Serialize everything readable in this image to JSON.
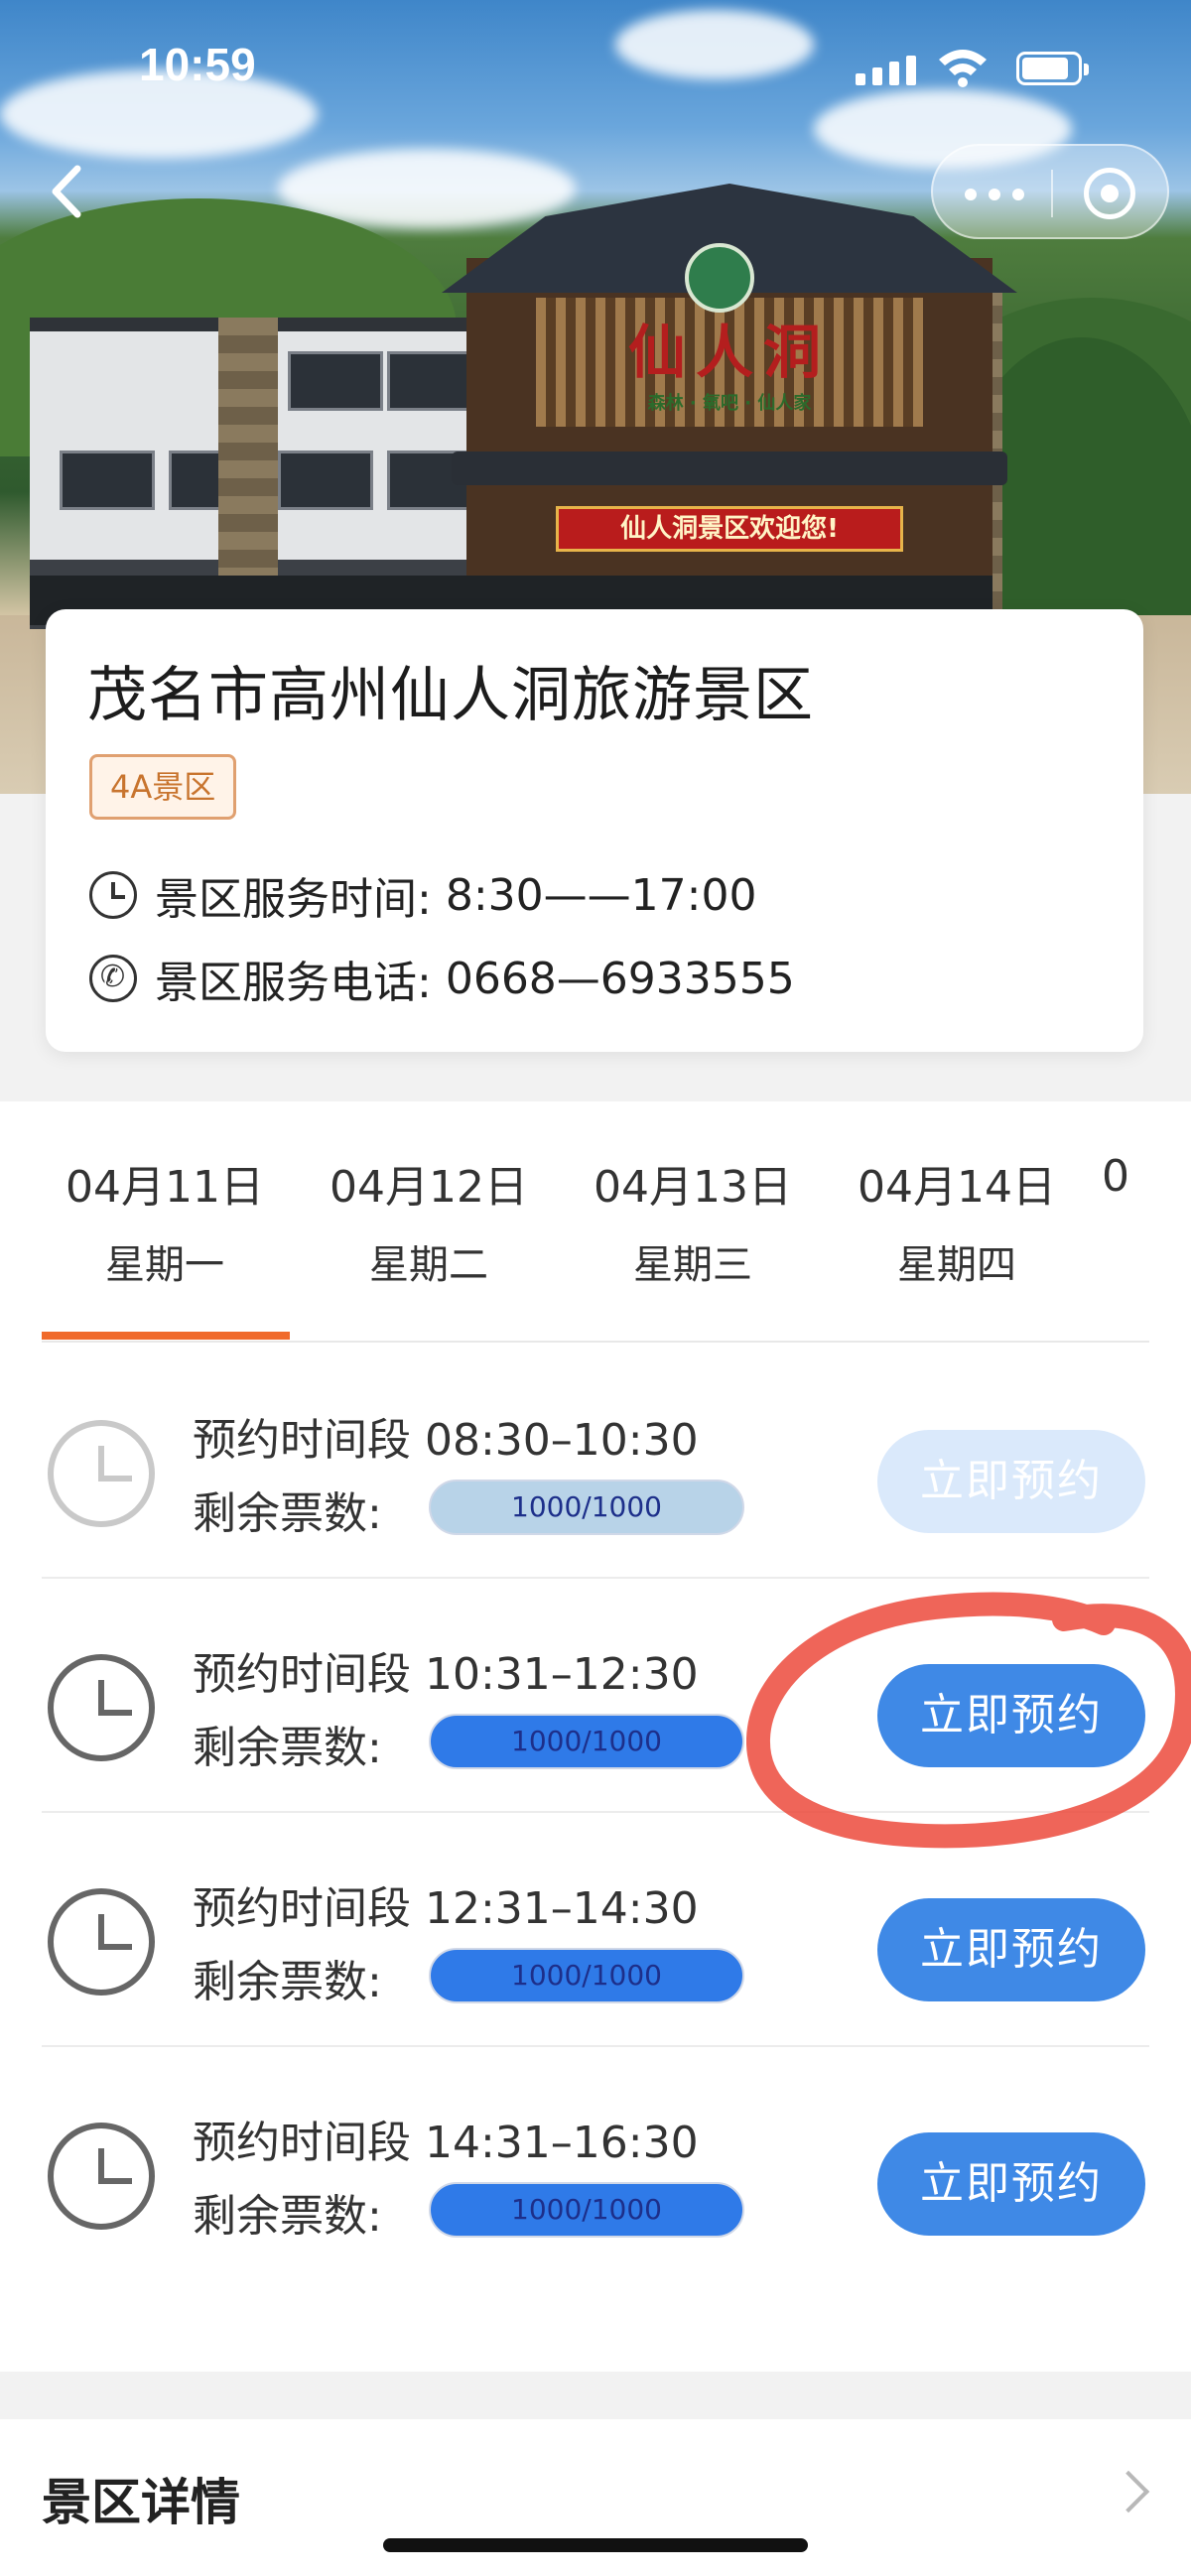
{
  "status_bar": {
    "time": "10:59"
  },
  "scenic": {
    "name": "茂名市高州仙人洞旅游景区",
    "tag": "4A景区",
    "service_hours_label": "景区服务时间:",
    "service_hours_value": "8:30——17:00",
    "phone_label": "景区服务电话:",
    "phone_value": "0668—6933555",
    "photo_sign": "仙人洞",
    "photo_sign_sub": "森林 · 氧吧 · 仙人家",
    "photo_banner": "仙人洞景区欢迎您!"
  },
  "date_tabs": [
    {
      "date": "04月11日",
      "weekday": "星期一",
      "active": true
    },
    {
      "date": "04月12日",
      "weekday": "星期二",
      "active": false
    },
    {
      "date": "04月13日",
      "weekday": "星期三",
      "active": false
    },
    {
      "date": "04月14日",
      "weekday": "星期四",
      "active": false
    },
    {
      "date": "0",
      "weekday": "",
      "active": false
    }
  ],
  "slots": [
    {
      "label": "预约时间段 08:30–10:30",
      "remain_label": "剩余票数:",
      "remaining": "1000/1000",
      "button": "立即预约",
      "enabled": false
    },
    {
      "label": "预约时间段 10:31–12:30",
      "remain_label": "剩余票数:",
      "remaining": "1000/1000",
      "button": "立即预约",
      "enabled": true
    },
    {
      "label": "预约时间段 12:31–14:30",
      "remain_label": "剩余票数:",
      "remaining": "1000/1000",
      "button": "立即预约",
      "enabled": true
    },
    {
      "label": "预约时间段 14:31–16:30",
      "remain_label": "剩余票数:",
      "remaining": "1000/1000",
      "button": "立即预约",
      "enabled": true
    }
  ],
  "details": {
    "title": "景区详情"
  },
  "colors": {
    "accent_orange": "#f06a2b",
    "primary_blue": "#3f89e6",
    "annotation_red": "#ec4a3c"
  },
  "icons": [
    "back-icon",
    "more-icon",
    "target-icon",
    "clock-icon",
    "phone-icon",
    "chevron-right-icon"
  ]
}
